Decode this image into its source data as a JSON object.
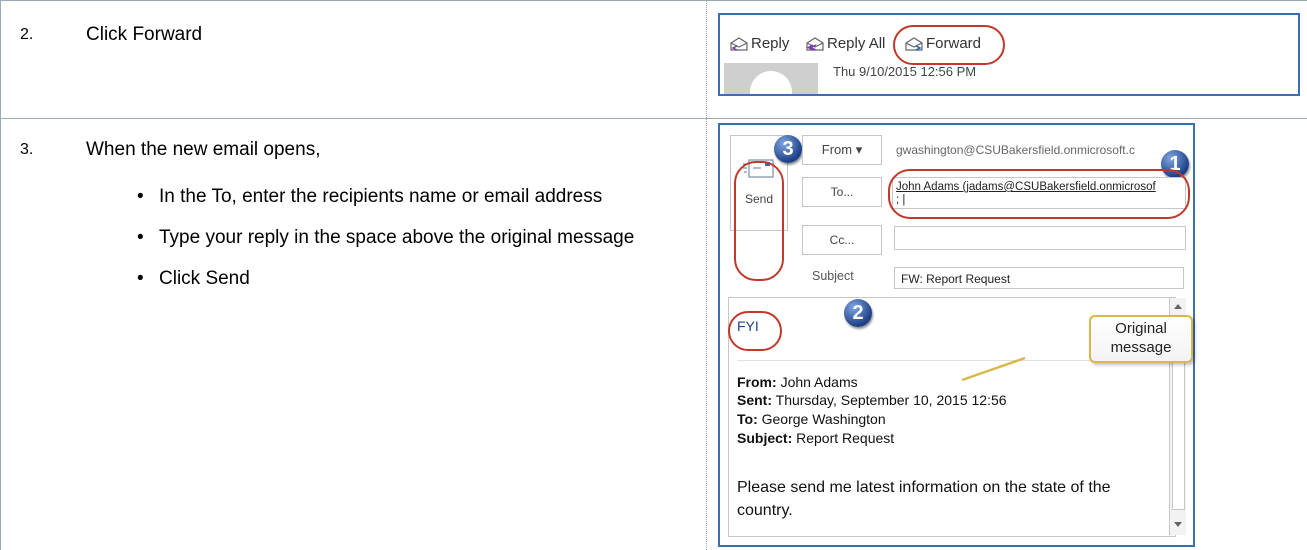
{
  "steps": [
    {
      "number": "2.",
      "text": "Click Forward"
    },
    {
      "number": "3.",
      "text": "When the new email opens,",
      "bullets": [
        "In the To, enter the recipients name or email address",
        "Type your reply in the space above the original message",
        "Click Send"
      ]
    }
  ],
  "toolbar_shot": {
    "reply_label": "Reply",
    "reply_all_label": "Reply All",
    "forward_label": "Forward",
    "date": "Thu 9/10/2015 12:56 PM"
  },
  "compose_shot": {
    "send_label": "Send",
    "from_label": "From ▾",
    "from_value": "gwashington@CSUBakersfield.onmicrosoft.c",
    "to_label": "To...",
    "to_value": "John Adams (jadams@CSUBakersfield.onmicrosof",
    "to_value_line2": ";",
    "cc_label": "Cc...",
    "subject_label": "Subject",
    "subject_value": "FW: Report Request",
    "body_fyi": "FYI",
    "from_key": "From:",
    "from_name": "John Adams",
    "sent_key": "Sent:",
    "sent_value": "Thursday, September 10, 2015 12:56",
    "to_key": "To:",
    "to_name": "George Washington",
    "subject_key": "Subject:",
    "subject_text": "Report Request",
    "message": "Please send me latest information on the state of the country.",
    "callout_text": "Original message",
    "badges": [
      "1",
      "2",
      "3"
    ]
  },
  "colors": {
    "accent_border": "#3a6fb0",
    "annotation_red": "#c0392b",
    "badge_blue": "#1d3f86",
    "callout_border": "#d9b74a"
  }
}
